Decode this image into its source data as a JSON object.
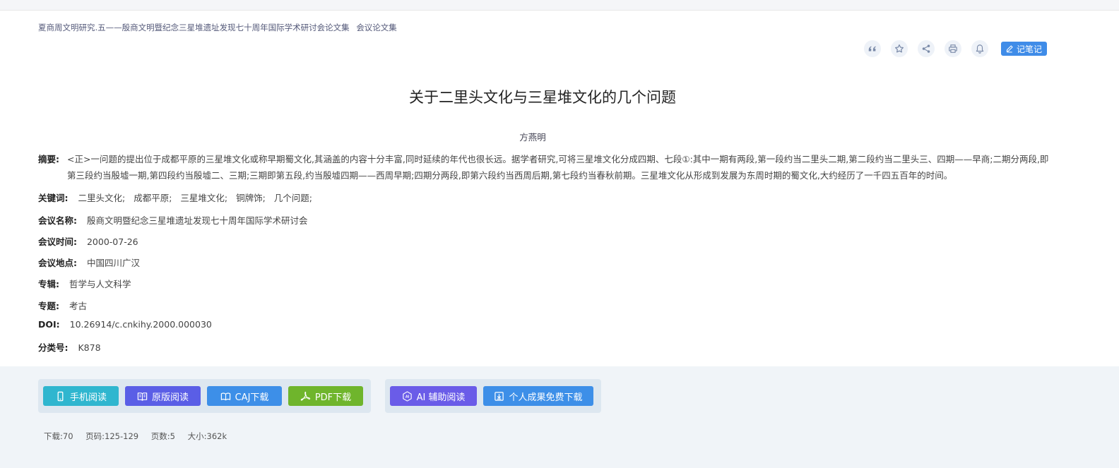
{
  "breadcrumb": {
    "source": "夏商周文明研究.五——殷商文明暨纪念三星堆遗址发现七十周年国际学术研讨会论文集",
    "type": "会议论文集"
  },
  "toolbar": {
    "icons": [
      "quote-icon",
      "star-icon",
      "share-icon",
      "print-icon",
      "bell-icon"
    ],
    "note_label": "记笔记"
  },
  "article": {
    "title": "关于二里头文化与三星堆文化的几个问题",
    "author": "方燕明",
    "abstract_label": "摘要:",
    "abstract": "<正>一问题的提出位于成都平原的三星堆文化或称早期蜀文化,其涵盖的内容十分丰富,同时延续的年代也很长远。据学者研究,可将三星堆文化分成四期、七段①:其中一期有两段,第一段约当二里头二期,第二段约当二里头三、四期——早商;二期分两段,即第三段约当殷墟一期,第四段约当殷墟二、三期;三期即第五段,约当殷墟四期——西周早期;四期分两段,即第六段约当西周后期,第七段约当春秋前期。三星堆文化从形成到发展为东周时期的蜀文化,大约经历了一千四五百年的时间。",
    "keywords_label": "关键词:",
    "keywords": [
      "二里头文化;",
      "成都平原;",
      "三星堆文化;",
      "铜牌饰;",
      "几个问题;"
    ],
    "conference_name_label": "会议名称:",
    "conference_name": "殷商文明暨纪念三星堆遗址发现七十周年国际学术研讨会",
    "conference_time_label": "会议时间:",
    "conference_time": "2000-07-26",
    "conference_place_label": "会议地点:",
    "conference_place": "中国四川广汉",
    "series_label": "专辑:",
    "series": "哲学与人文科学",
    "subject_label": "专题:",
    "subject": "考古",
    "doi_label": "DOI:",
    "doi": "10.26914/c.cnkihy.2000.000030",
    "classno_label": "分类号:",
    "classno": "K878"
  },
  "actions": {
    "mobile_read": "手机阅读",
    "original_read": "原版阅读",
    "caj_download": "CAJ下载",
    "pdf_download": "PDF下载",
    "ai_read": "AI 辅助阅读",
    "free_download": "个人成果免费下载"
  },
  "stats": {
    "downloads": "下载:70",
    "pages": "页码:125-129",
    "page_count": "页数:5",
    "size": "大小:362k"
  },
  "colors": {
    "mobile": "#2fb6cf",
    "original": "#5a5ee6",
    "caj": "#3d8fe8",
    "pdf": "#6fb52c",
    "ai": "#6a5ce8",
    "free": "#3d8fe8",
    "note": "#3f8ce8"
  }
}
